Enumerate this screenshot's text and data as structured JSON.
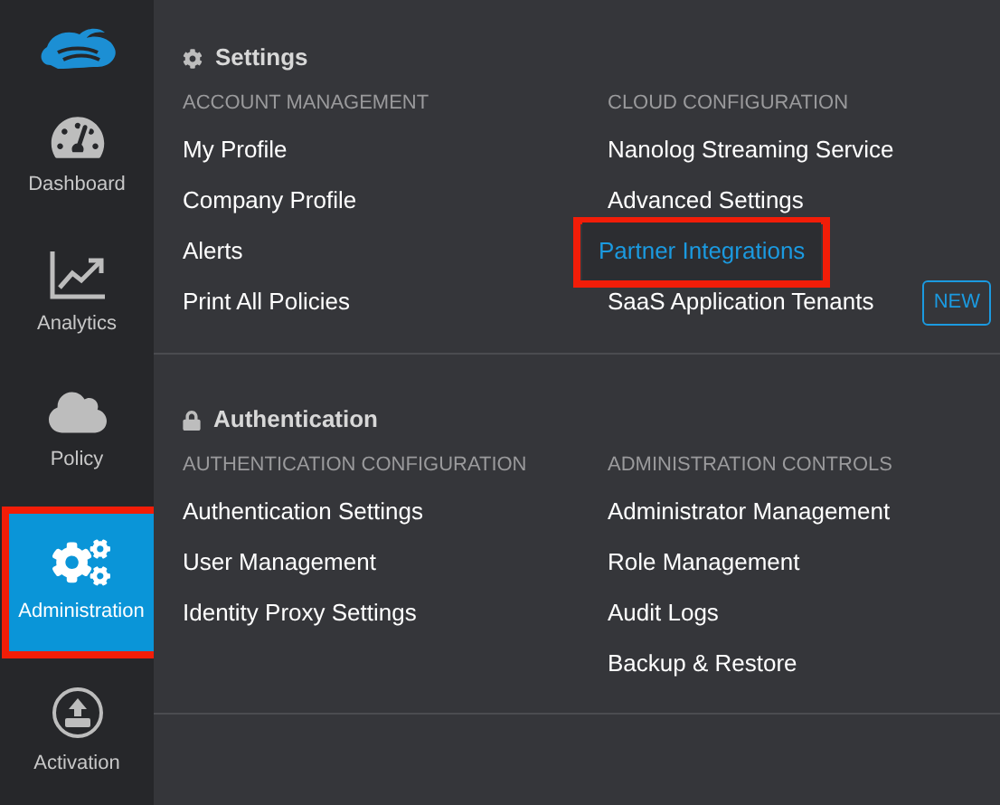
{
  "sidebar": {
    "items": [
      {
        "label": "Dashboard",
        "selected": false,
        "highlighted": false
      },
      {
        "label": "Analytics",
        "selected": false,
        "highlighted": false
      },
      {
        "label": "Policy",
        "selected": false,
        "highlighted": false
      },
      {
        "label": "Administration",
        "selected": true,
        "highlighted": true
      },
      {
        "label": "Activation",
        "selected": false,
        "highlighted": false
      }
    ]
  },
  "menu": {
    "sections": [
      {
        "title": "Settings",
        "columns": [
          {
            "heading": "ACCOUNT MANAGEMENT",
            "items": [
              {
                "label": "My Profile",
                "selected": false,
                "highlighted": false
              },
              {
                "label": "Company Profile",
                "selected": false,
                "highlighted": false
              },
              {
                "label": "Alerts",
                "selected": false,
                "highlighted": false
              },
              {
                "label": "Print All Policies",
                "selected": false,
                "highlighted": false
              }
            ]
          },
          {
            "heading": "CLOUD CONFIGURATION",
            "items": [
              {
                "label": "Nanolog Streaming Service",
                "selected": false,
                "highlighted": false
              },
              {
                "label": "Advanced Settings",
                "selected": false,
                "highlighted": false
              },
              {
                "label": "Partner Integrations",
                "selected": true,
                "highlighted": true
              },
              {
                "label": "SaaS Application Tenants",
                "selected": false,
                "highlighted": false,
                "badge": "NEW"
              }
            ]
          }
        ]
      },
      {
        "title": "Authentication",
        "columns": [
          {
            "heading": "AUTHENTICATION CONFIGURATION",
            "items": [
              {
                "label": "Authentication Settings",
                "selected": false,
                "highlighted": false
              },
              {
                "label": "User Management",
                "selected": false,
                "highlighted": false
              },
              {
                "label": "Identity Proxy Settings",
                "selected": false,
                "highlighted": false
              }
            ]
          },
          {
            "heading": "ADMINISTRATION CONTROLS",
            "items": [
              {
                "label": "Administrator Management",
                "selected": false,
                "highlighted": false
              },
              {
                "label": "Role Management",
                "selected": false,
                "highlighted": false
              },
              {
                "label": "Audit Logs",
                "selected": false,
                "highlighted": false
              },
              {
                "label": "Backup & Restore",
                "selected": false,
                "highlighted": false
              }
            ]
          }
        ]
      }
    ]
  }
}
